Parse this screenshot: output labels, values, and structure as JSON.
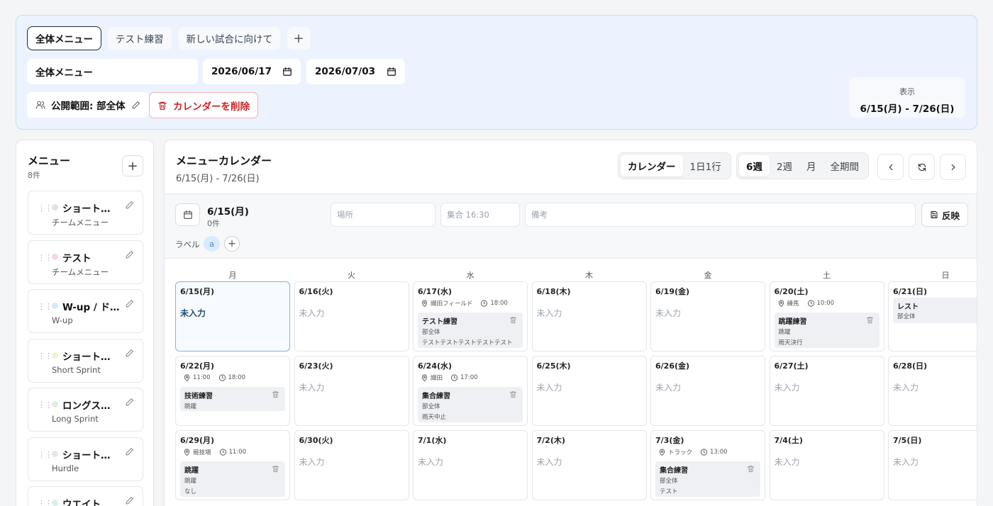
{
  "top": {
    "tabs": [
      "全体メニュー",
      "テスト練習",
      "新しい試合に向けて"
    ],
    "tab_add": "+",
    "calendar_name": "全体メニュー",
    "start_date": "2026/06/17",
    "end_date": "2026/07/03",
    "visibility": "公開範囲: 部全体",
    "delete_label": "カレンダーを削除",
    "display_label": "表示",
    "display_range": "6/15(月) - 7/26(日)"
  },
  "sidebar": {
    "title": "メニュー",
    "count": "8件",
    "add": "+",
    "items": [
      {
        "name": "ショート…",
        "sub": "チームメニュー",
        "color": "#dfe3e8"
      },
      {
        "name": "テスト",
        "sub": "チームメニュー",
        "color": "#f8d7da"
      },
      {
        "name": "W-up / ド…",
        "sub": "W-up",
        "color": "#dbe7fb"
      },
      {
        "name": "ショート…",
        "sub": "Short Sprint",
        "color": "#f1f3cf"
      },
      {
        "name": "ロングス…",
        "sub": "Long Sprint",
        "color": "#d7f2dd"
      },
      {
        "name": "ショート…",
        "sub": "Hurdle",
        "color": "#e5e7eb"
      },
      {
        "name": "ウエイト",
        "sub": "",
        "color": "#d7f2e9"
      }
    ]
  },
  "main": {
    "title": "メニューカレンダー",
    "range": "6/15(月) - 7/26(日)",
    "view_modes": [
      "カレンダー",
      "1日1行"
    ],
    "periods": [
      "6週",
      "2週",
      "月",
      "全期間"
    ],
    "selected_view": "カレンダー",
    "selected_period": "6週"
  },
  "day_panel": {
    "date": "6/15(月)",
    "count": "0件",
    "place_ph": "場所",
    "time_ph": "集合 16:30",
    "note_ph": "備考",
    "apply": "反映",
    "label_title": "ラベル",
    "label_chip": "a",
    "label_add": "+"
  },
  "weekdays": [
    "月",
    "火",
    "水",
    "木",
    "金",
    "土",
    "日"
  ],
  "empty_text": "未入力",
  "weeks": [
    [
      {
        "date": "6/15(月)",
        "selected": true
      },
      {
        "date": "6/16(火)"
      },
      {
        "date": "6/17(水)",
        "place": "織田フィールド",
        "time": "18:00",
        "event": {
          "title": "テスト練習",
          "l1": "部全体",
          "l2": "テストテストテストテストテスト"
        }
      },
      {
        "date": "6/18(木)"
      },
      {
        "date": "6/19(金)"
      },
      {
        "date": "6/20(土)",
        "place": "練馬",
        "time": "10:00",
        "event": {
          "title": "跳躍練習",
          "l1": "跳躍",
          "l2": "雨天決行"
        }
      },
      {
        "date": "6/21(日)",
        "rest": {
          "title": "レスト",
          "l1": "部全体"
        }
      }
    ],
    [
      {
        "date": "6/22(月)",
        "place": "11:00",
        "time": "18:00",
        "event": {
          "title": "技術練習",
          "l1": "跳躍",
          "l2": ""
        }
      },
      {
        "date": "6/23(火)"
      },
      {
        "date": "6/24(水)",
        "place": "織田",
        "time": "17:00",
        "event": {
          "title": "集合練習",
          "l1": "部全体",
          "l2": "雨天中止"
        }
      },
      {
        "date": "6/25(木)"
      },
      {
        "date": "6/26(金)"
      },
      {
        "date": "6/27(土)"
      },
      {
        "date": "6/28(日)"
      }
    ],
    [
      {
        "date": "6/29(月)",
        "place": "競技場",
        "time": "11:00",
        "event": {
          "title": "跳躍",
          "l1": "跳躍",
          "l2": "なし"
        }
      },
      {
        "date": "6/30(火)"
      },
      {
        "date": "7/1(水)"
      },
      {
        "date": "7/2(木)"
      },
      {
        "date": "7/3(金)",
        "place": "トラック",
        "time": "13:00",
        "event": {
          "title": "集合練習",
          "l1": "部全体",
          "l2": "テスト"
        }
      },
      {
        "date": "7/4(土)"
      },
      {
        "date": "7/5(日)"
      }
    ]
  ],
  "icons": {
    "calendar": "calendar-icon",
    "users": "users-icon",
    "pencil": "pencil-icon",
    "trash": "trash-icon",
    "pin": "map-pin-icon",
    "clock": "clock-icon",
    "save": "save-icon",
    "refresh": "refresh-icon",
    "prev": "chevron-left-icon",
    "next": "chevron-right-icon",
    "grip": "drag-handle-icon"
  },
  "colors": {
    "accent": "#1f2937",
    "danger": "#cc2222",
    "selected": "#7db3ea",
    "top_bg": "#ecf3fe"
  }
}
